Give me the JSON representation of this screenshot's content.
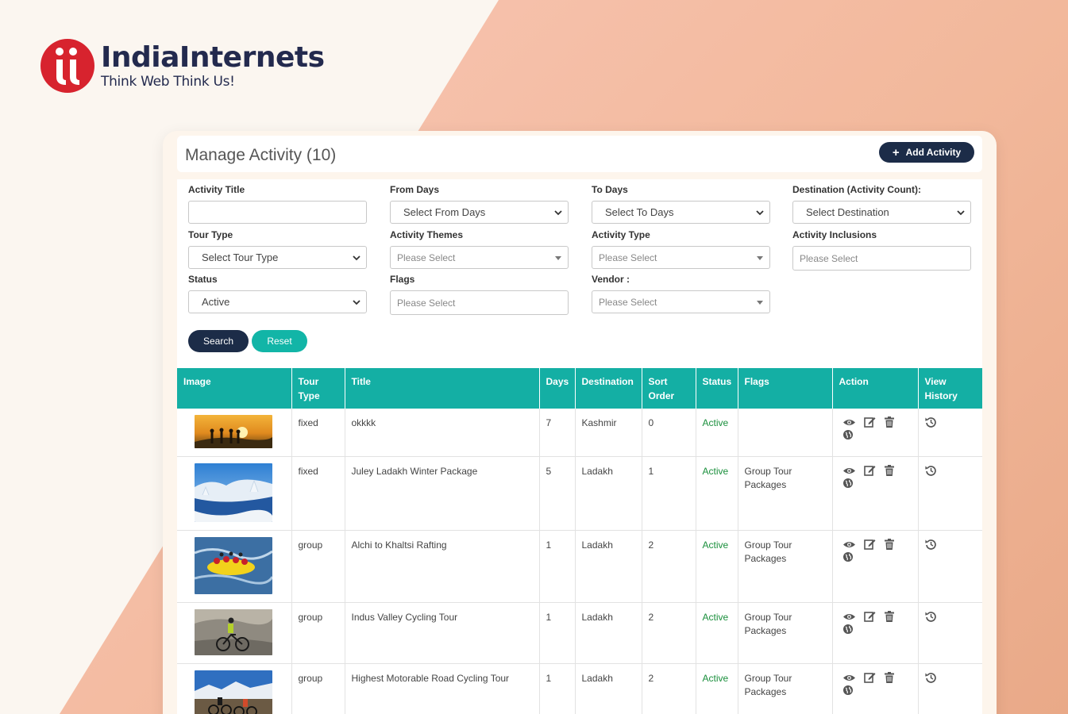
{
  "brand": {
    "name": "IndiaInternets",
    "tagline": "Think Web Think Us!"
  },
  "header": {
    "title": "Manage Activity (10)",
    "add_label": "Add Activity"
  },
  "filters": {
    "activity_title": {
      "label": "Activity Title",
      "value": ""
    },
    "from_days": {
      "label": "From Days",
      "value": "Select From Days"
    },
    "to_days": {
      "label": "To Days",
      "value": "Select To Days"
    },
    "destination": {
      "label": "Destination (Activity Count):",
      "value": "Select Destination"
    },
    "tour_type": {
      "label": "Tour Type",
      "value": "Select Tour Type"
    },
    "activity_themes": {
      "label": "Activity Themes",
      "placeholder": "Please Select"
    },
    "activity_type": {
      "label": "Activity Type",
      "placeholder": "Please Select"
    },
    "activity_inclusions": {
      "label": "Activity Inclusions",
      "placeholder": "Please Select"
    },
    "status": {
      "label": "Status",
      "value": "Active"
    },
    "flags": {
      "label": "Flags",
      "placeholder": "Please Select"
    },
    "vendor": {
      "label": "Vendor :",
      "placeholder": "Please Select"
    },
    "search_label": "Search",
    "reset_label": "Reset"
  },
  "table": {
    "columns": [
      "Image",
      "Tour Type",
      "Title",
      "Days",
      "Destination",
      "Sort Order",
      "Status",
      "Flags",
      "Action",
      "View History"
    ],
    "rows": [
      {
        "tour_type": "fixed",
        "title": "okkkk",
        "days": "7",
        "destination": "Kashmir",
        "sort_order": "0",
        "status": "Active",
        "flags": ""
      },
      {
        "tour_type": "fixed",
        "title": "Juley Ladakh Winter Package",
        "days": "5",
        "destination": "Ladakh",
        "sort_order": "1",
        "status": "Active",
        "flags": "Group Tour Packages"
      },
      {
        "tour_type": "group",
        "title": "Alchi to Khaltsi Rafting",
        "days": "1",
        "destination": "Ladakh",
        "sort_order": "2",
        "status": "Active",
        "flags": "Group Tour Packages"
      },
      {
        "tour_type": "group",
        "title": "Indus Valley Cycling Tour",
        "days": "1",
        "destination": "Ladakh",
        "sort_order": "2",
        "status": "Active",
        "flags": "Group Tour Packages"
      },
      {
        "tour_type": "group",
        "title": "Highest Motorable Road Cycling Tour",
        "days": "1",
        "destination": "Ladakh",
        "sort_order": "2",
        "status": "Active",
        "flags": "Group Tour Packages"
      }
    ]
  },
  "colors": {
    "teal": "#14afa4",
    "navy": "#1c2c48",
    "brand_red": "#d7232e",
    "active_green": "#1a8f3c"
  }
}
